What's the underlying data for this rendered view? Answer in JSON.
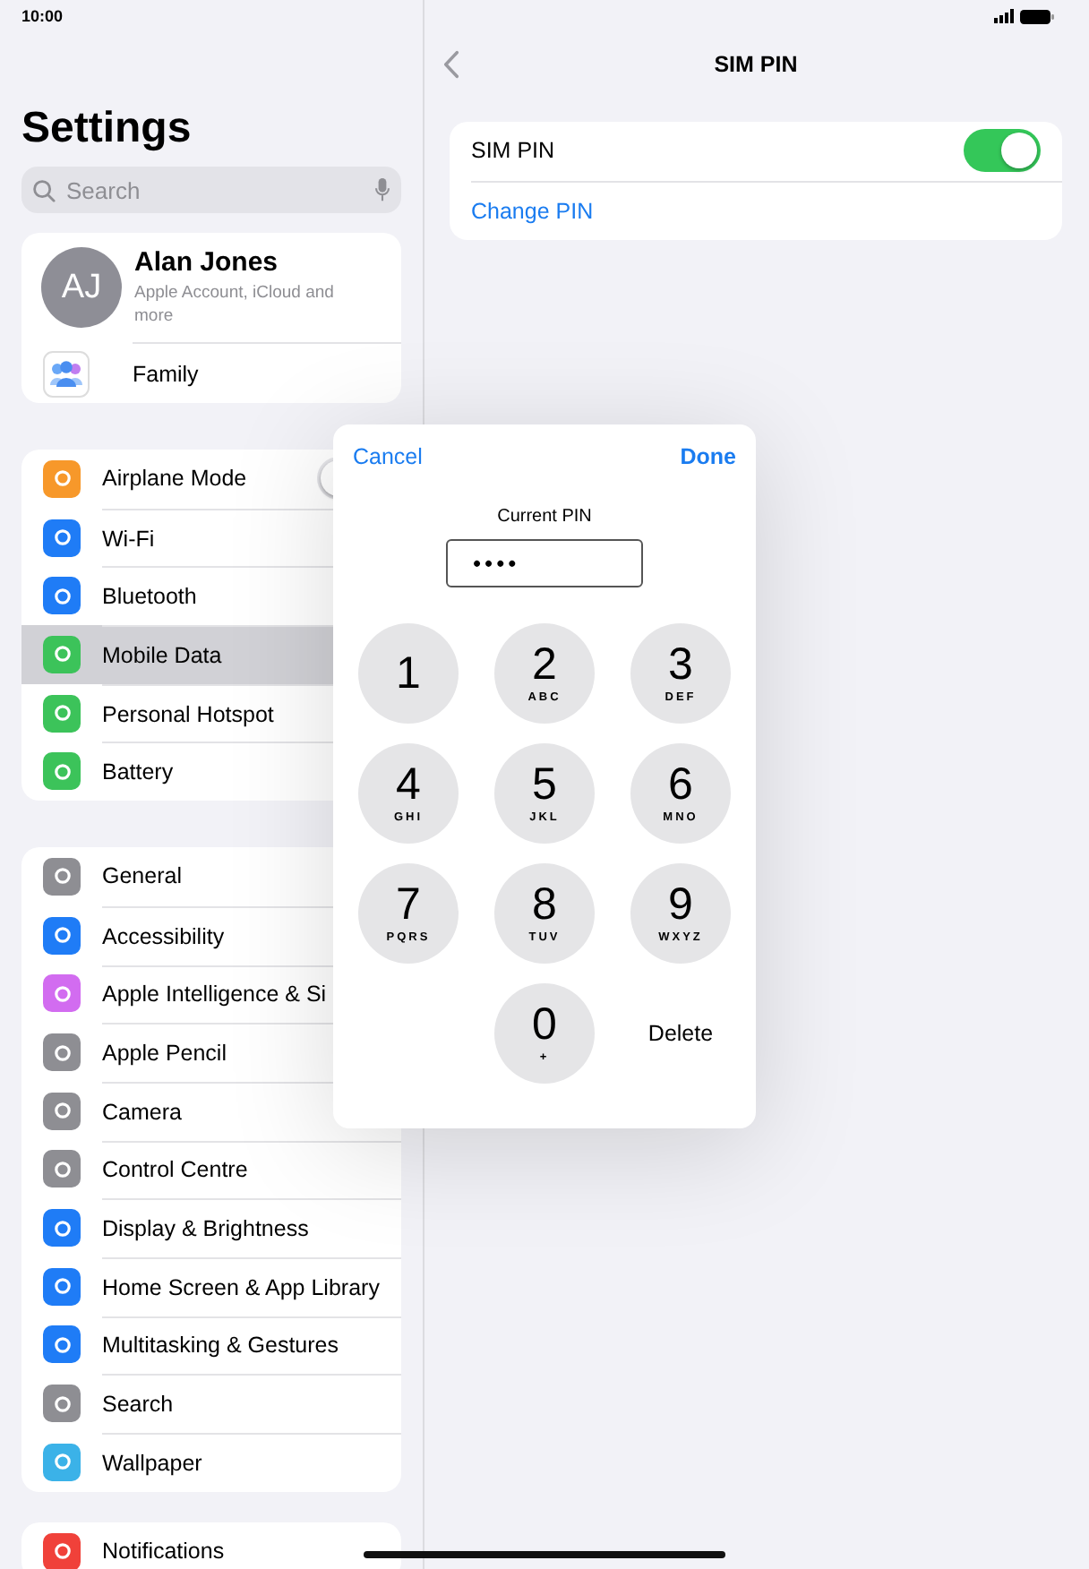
{
  "status_bar": {
    "time": "10:00"
  },
  "sidebar": {
    "title": "Settings",
    "search": {
      "placeholder": "Search"
    },
    "account": {
      "initials": "AJ",
      "name": "Alan Jones",
      "subtitle": "Apple Account, iCloud and more",
      "family": "Family"
    },
    "groups": [
      [
        {
          "label": "Airplane Mode",
          "color": "#f7982a",
          "kind": "toggle",
          "on": false,
          "selected": false
        },
        {
          "label": "Wi-Fi",
          "color": "#1f7cf6",
          "kind": "link",
          "selected": false
        },
        {
          "label": "Bluetooth",
          "color": "#1f7cf6",
          "kind": "link",
          "selected": false
        },
        {
          "label": "Mobile Data",
          "color": "#3cc35a",
          "kind": "link",
          "selected": true
        },
        {
          "label": "Personal Hotspot",
          "color": "#3cc35a",
          "kind": "link",
          "selected": false
        },
        {
          "label": "Battery",
          "color": "#3cc35a",
          "kind": "link",
          "selected": false
        }
      ],
      [
        {
          "label": "General",
          "color": "#8e8e93",
          "kind": "link",
          "selected": false
        },
        {
          "label": "Accessibility",
          "color": "#1f7cf6",
          "kind": "link",
          "selected": false
        },
        {
          "label": "Apple Intelligence & Si",
          "color": "#d26cf0",
          "kind": "link",
          "selected": false
        },
        {
          "label": "Apple Pencil",
          "color": "#8e8e93",
          "kind": "link",
          "selected": false
        },
        {
          "label": "Camera",
          "color": "#8e8e93",
          "kind": "link",
          "selected": false
        },
        {
          "label": "Control Centre",
          "color": "#8e8e93",
          "kind": "link",
          "selected": false
        },
        {
          "label": "Display & Brightness",
          "color": "#1f7cf6",
          "kind": "link",
          "selected": false
        },
        {
          "label": "Home Screen & App Library",
          "color": "#1f7cf6",
          "kind": "link",
          "selected": false
        },
        {
          "label": "Multitasking & Gestures",
          "color": "#1f7cf6",
          "kind": "link",
          "selected": false
        },
        {
          "label": "Search",
          "color": "#8e8e93",
          "kind": "link",
          "selected": false
        },
        {
          "label": "Wallpaper",
          "color": "#3bb2e8",
          "kind": "link",
          "selected": false
        }
      ],
      [
        {
          "label": "Notifications",
          "color": "#f0413a",
          "kind": "link",
          "selected": false
        }
      ]
    ]
  },
  "detail": {
    "title": "SIM PIN",
    "rows": [
      {
        "label": "SIM PIN",
        "kind": "toggle",
        "on": true
      },
      {
        "label": "Change PIN",
        "kind": "link"
      }
    ]
  },
  "pin_dialog": {
    "cancel": "Cancel",
    "done": "Done",
    "prompt": "Current PIN",
    "value": "••••",
    "keys": [
      {
        "digit": "1"
      },
      {
        "digit": "2",
        "letters": "ABC"
      },
      {
        "digit": "3",
        "letters": "DEF"
      },
      {
        "digit": "4",
        "letters": "GHI"
      },
      {
        "digit": "5",
        "letters": "JKL"
      },
      {
        "digit": "6",
        "letters": "MNO"
      },
      {
        "digit": "7",
        "letters": "PQRS"
      },
      {
        "digit": "8",
        "letters": "TUV"
      },
      {
        "digit": "9",
        "letters": "WXYZ"
      },
      {
        "digit": "0",
        "letters": "+"
      }
    ],
    "delete": "Delete"
  }
}
